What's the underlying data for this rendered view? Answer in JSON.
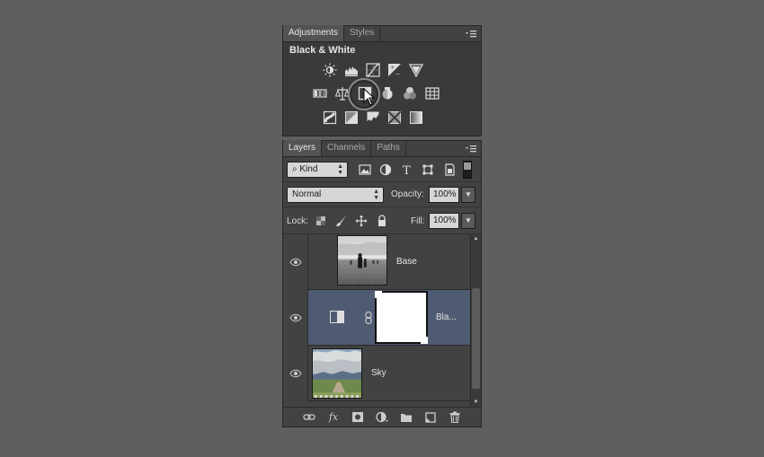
{
  "adjustments_panel": {
    "tabs": [
      "Adjustments",
      "Styles"
    ],
    "title": "Black & White",
    "row1_icons": [
      "brightness-contrast-icon",
      "levels-icon",
      "curves-icon",
      "exposure-icon",
      "vibrance-icon"
    ],
    "row2_icons": [
      "hue-saturation-icon",
      "color-balance-icon",
      "black-white-icon",
      "photo-filter-icon",
      "channel-mixer-icon",
      "color-lookup-icon"
    ],
    "row3_icons": [
      "invert-icon",
      "posterize-icon",
      "threshold-icon",
      "selective-color-icon",
      "gradient-map-icon"
    ]
  },
  "layers_panel": {
    "tabs": [
      "Layers",
      "Channels",
      "Paths"
    ],
    "filter_kind": "Kind",
    "blend_mode": "Normal",
    "opacity_label": "Opacity:",
    "opacity_value": "100%",
    "lock_label": "Lock:",
    "fill_label": "Fill:",
    "fill_value": "100%",
    "layers": [
      {
        "name": "Base",
        "visible": true,
        "selected": false
      },
      {
        "name": "Bla...",
        "visible": true,
        "selected": true
      },
      {
        "name": "Sky",
        "visible": true,
        "selected": false
      }
    ],
    "fx_label": "fx"
  },
  "colors": {
    "background": "#5f5f5f",
    "panel": "#535353",
    "selected_layer": "#4f5b72"
  }
}
